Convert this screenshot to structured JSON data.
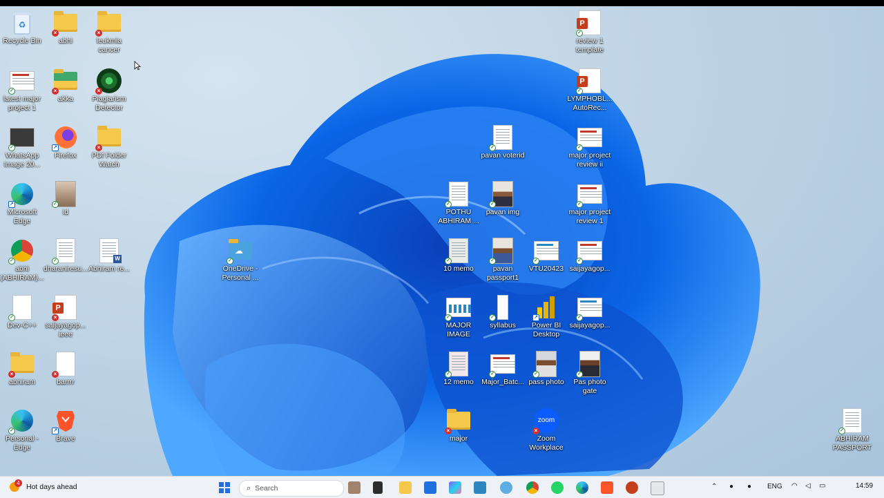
{
  "desktop_icons": {
    "recycle_bin": "Recycle Bin",
    "abhi": "abhi",
    "leukemia": "leukmia cancer",
    "latest_major": "latest major project 1",
    "akka": "akka",
    "plagiarism": "Plagiarism Detector",
    "whatsapp_img": "WhatsApp Image 20...",
    "firefox": "Firefox",
    "pdf_watch": "PDf Folder Watch",
    "ms_edge": "Microsoft Edge",
    "id": "id",
    "abhi_chrome": "abhi (ABHIRAM)...",
    "dharani": "dharaniresu...",
    "abhiram_re": "Abhiram re...",
    "devcpp": "Dev-C++",
    "saijaya_ieee": "saijayagop... ieee",
    "abhiram": "abhiram",
    "barrrr": "barrrr",
    "personal_edge": "Personal - Edge",
    "brave": "Brave",
    "onedrive": "OneDrive - Personal ...",
    "review_template": "review 1 template",
    "lymphobl": "LYMPHOBL... AutoRec...",
    "pavan_voterid": "pavan voterid",
    "major_review_ii": "major project review ii",
    "pothu": "POTHU ABHIRAM ...",
    "pavan_img": "pavan img",
    "major_review_1": "major project review 1",
    "memo10": "10 memo",
    "pavan_passport": "pavan passport1",
    "vtu": "VTU20423",
    "saijaya1": "saijayagop...",
    "major_image": "MAJOR IMAGE",
    "syllabus": "syllabus",
    "powerbi": "Power BI Desktop",
    "saijaya2": "saijayagop...",
    "memo12": "12 memo",
    "major_batc": "Major_Batc...",
    "pass_photo": "pass photo",
    "pas_photo_gate": "Pas photo gate",
    "major": "major",
    "zoom": "Zoom Workplace",
    "zoom_glyph": "zoom",
    "abhiram_passport": "ABHIRAM PASSPORT"
  },
  "taskbar": {
    "weather_badge": "4",
    "weather_text": "Hot days ahead",
    "search_placeholder": "Search",
    "language": "ENG",
    "time": "14:59"
  },
  "colors": {
    "accent": "#1f6fe0",
    "wallpaper_blue": "#0a5ad6"
  },
  "icons": [
    "recycle-bin-icon",
    "folder-icon",
    "document-icon",
    "powerpoint-icon",
    "edge-icon",
    "chrome-icon",
    "firefox-icon",
    "brave-icon",
    "onedrive-icon",
    "powerbi-icon",
    "zoom-icon",
    "windows-start-icon",
    "search-icon"
  ]
}
